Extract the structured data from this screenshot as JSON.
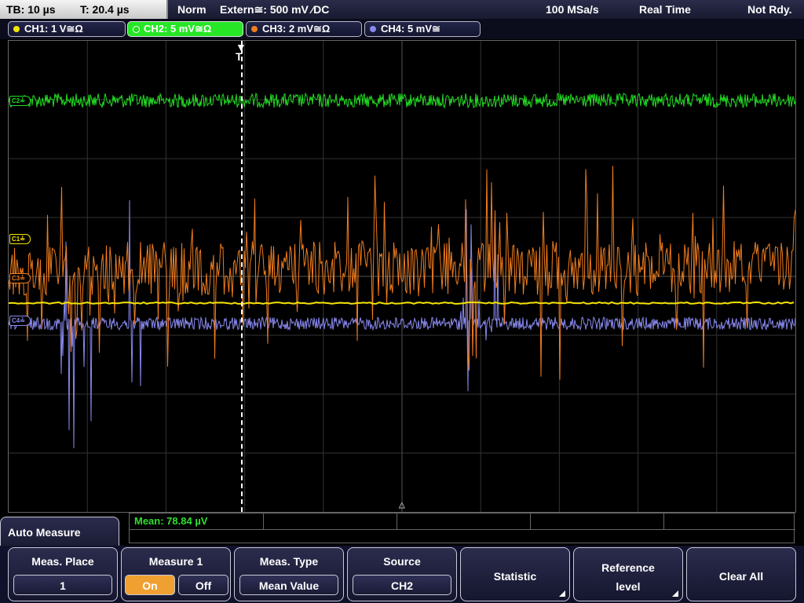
{
  "status_bar": {
    "timebase": "TB: 10 µs",
    "trigger_time": "T: 20.4 µs",
    "trigger_mode": "Norm",
    "trigger_source": "Extern≅: 500 mV ⁄DC",
    "sample_rate": "100 MSa/s",
    "acquisition_mode": "Real Time",
    "acq_status": "Not Rdy."
  },
  "channels": [
    {
      "label": "CH1: 1 V≅Ω",
      "color": "#f5e400",
      "marker": "C1≟",
      "active": false
    },
    {
      "label": "CH2: 5 mV≅Ω",
      "color": "#22dd22",
      "marker": "C2≟",
      "active": true
    },
    {
      "label": "CH3: 2 mV≅Ω",
      "color": "#f07d1e",
      "marker": "C3≟",
      "active": false
    },
    {
      "label": "CH4: 5 mV≅",
      "color": "#8888ee",
      "marker": "C4≟",
      "active": false
    }
  ],
  "measurement": {
    "mean_readout": "Mean: 78.84 µV"
  },
  "menu": {
    "title": "Auto Measure",
    "meas_place_label": "Meas. Place",
    "meas_place_value": "1",
    "measure1_label": "Measure 1",
    "on_label": "On",
    "off_label": "Off",
    "meas_type_label": "Meas. Type",
    "meas_type_value": "Mean Value",
    "source_label": "Source",
    "source_value": "CH2",
    "statistic_label": "Statistic",
    "reference_label_1": "Reference",
    "reference_label_2": "level",
    "clear_all_label": "Clear All"
  },
  "icons": {
    "trigger": "trigger-marker-icon",
    "channel_dot": "channel-dot-icon",
    "submenu": "submenu-corner-icon"
  }
}
